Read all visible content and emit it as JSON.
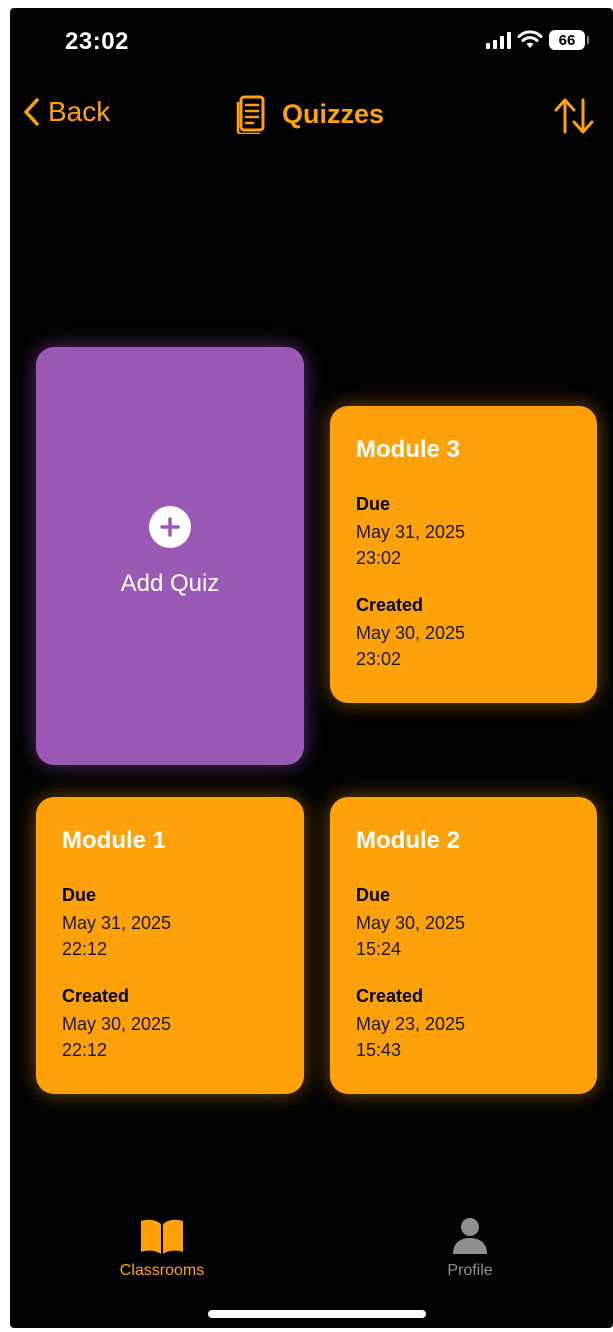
{
  "status_bar": {
    "time": "23:02",
    "battery": "66"
  },
  "nav": {
    "back_label": "Back",
    "title": "Quizzes",
    "title_icon": "document-icon",
    "sort_icon": "sort-arrows-icon"
  },
  "add_card": {
    "label": "Add Quiz",
    "icon": "plus-circle-icon"
  },
  "quizzes": [
    {
      "title": "Module 3",
      "due_label": "Due",
      "due_value": "May 31, 2025\n23:02",
      "created_label": "Created",
      "created_value": "May 30, 2025\n23:02"
    },
    {
      "title": "Module 1",
      "due_label": "Due",
      "due_value": "May 31, 2025\n22:12",
      "created_label": "Created",
      "created_value": "May 30, 2025\n22:12"
    },
    {
      "title": "Module 2",
      "due_label": "Due",
      "due_value": "May 30, 2025\n15:24",
      "created_label": "Created",
      "created_value": "May 23, 2025\n15:43"
    }
  ],
  "tabs": [
    {
      "label": "Classrooms",
      "icon": "book-icon",
      "active": true
    },
    {
      "label": "Profile",
      "icon": "person-icon",
      "active": false
    }
  ],
  "colors": {
    "accent": "#FFA10A",
    "add_card": "#9B59B6",
    "background": "#000000",
    "inactive_tab": "#8E8E93"
  }
}
